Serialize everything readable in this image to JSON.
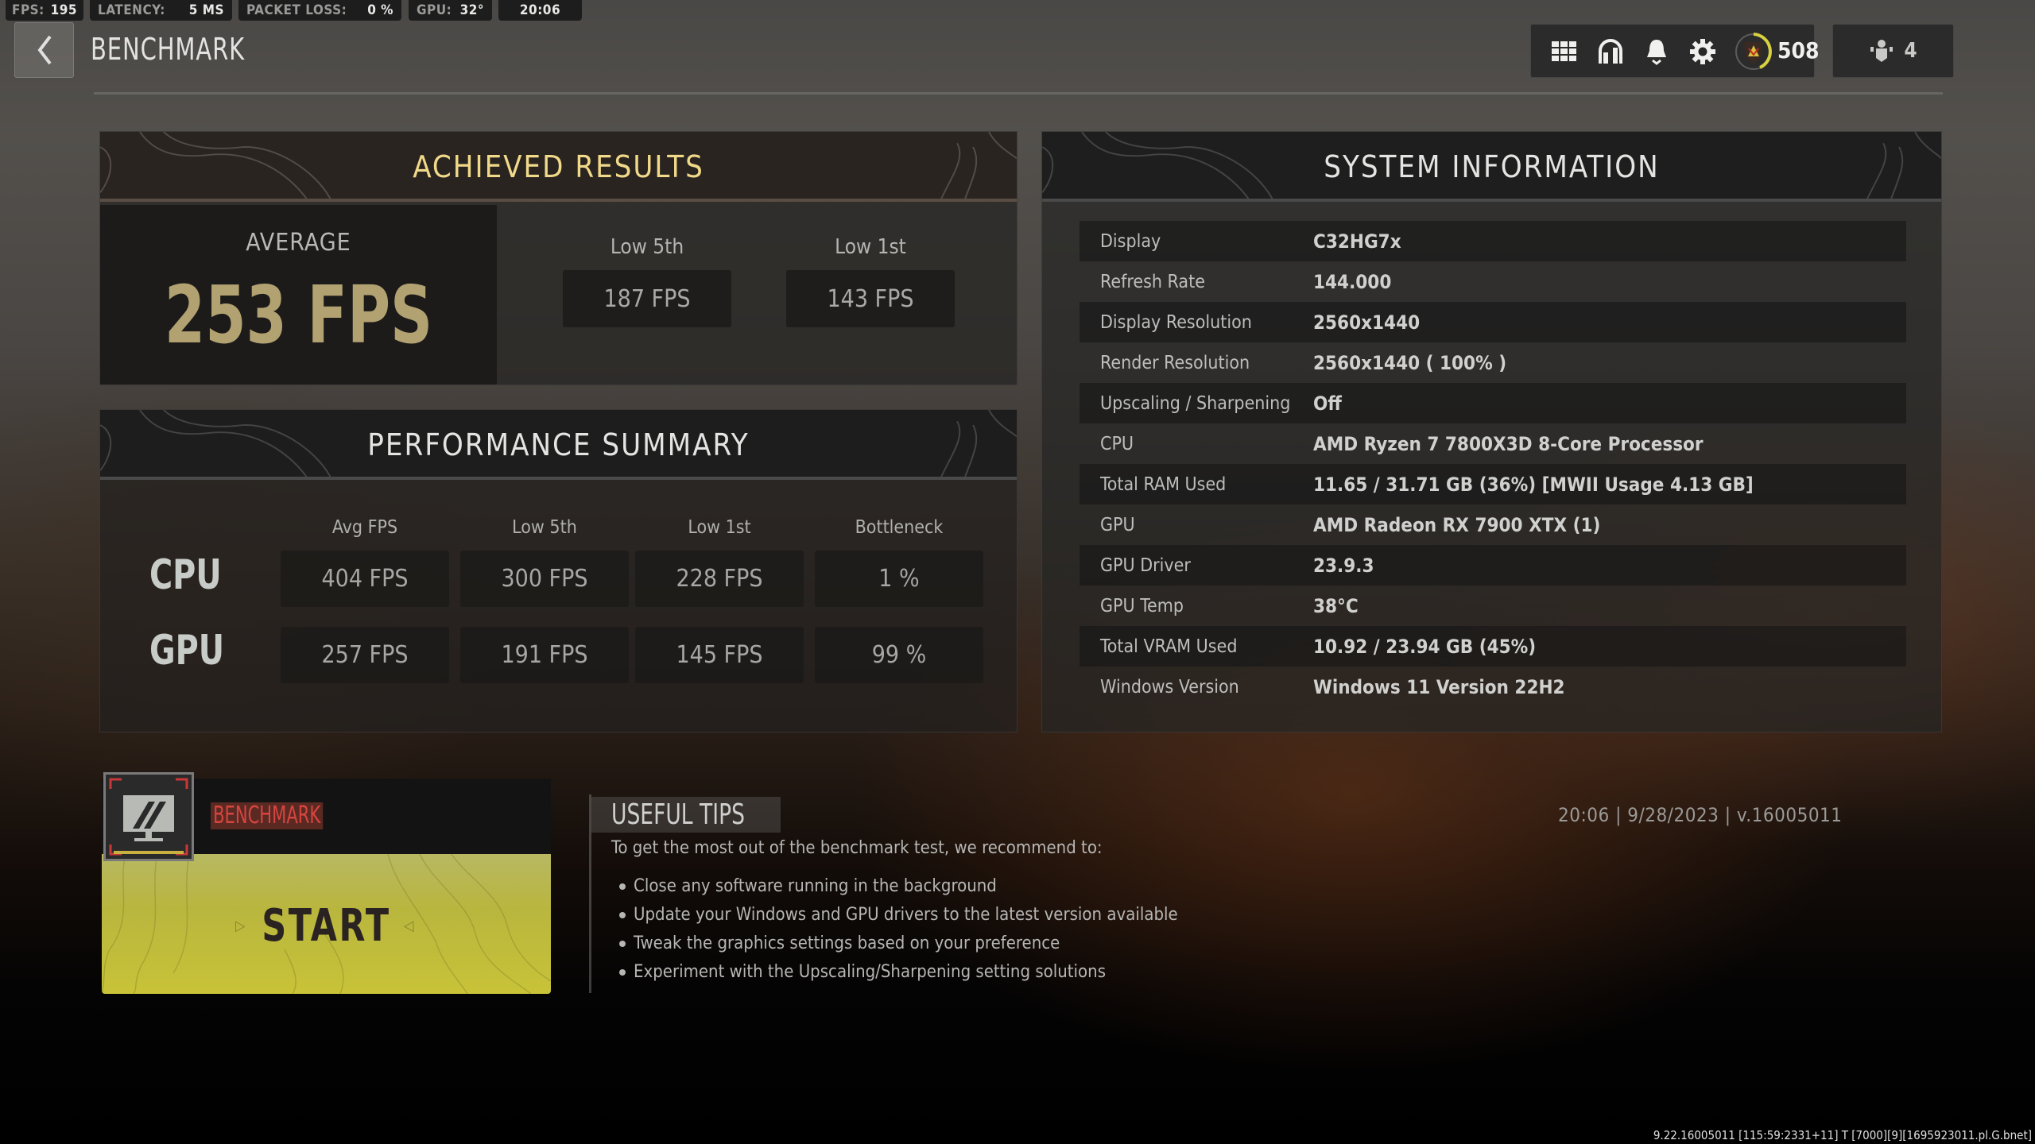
{
  "status_bar": [
    {
      "key": "FPS:",
      "value": "195"
    },
    {
      "key": "LATENCY:",
      "value": "5 MS"
    },
    {
      "key": "PACKET LOSS:",
      "value": "0 %"
    },
    {
      "key": "GPU:",
      "value": "32°"
    },
    {
      "key": "",
      "value": "20:06"
    }
  ],
  "header": {
    "title": "BENCHMARK",
    "icons": [
      "grid-menu-icon",
      "headset-icon",
      "bell-icon",
      "gear-icon",
      "rank-emblem-icon"
    ],
    "rank_value": "508",
    "party_count": "4"
  },
  "achieved": {
    "title": "ACHIEVED RESULTS",
    "average_label": "AVERAGE",
    "average_value": "253 FPS",
    "low5_label": "Low 5th",
    "low5_value": "187 FPS",
    "low1_label": "Low 1st",
    "low1_value": "143 FPS"
  },
  "performance": {
    "title": "PERFORMANCE SUMMARY",
    "columns": [
      "Avg FPS",
      "Low 5th",
      "Low 1st",
      "Bottleneck"
    ],
    "rows": [
      {
        "label": "CPU",
        "values": [
          "404 FPS",
          "300 FPS",
          "228 FPS",
          "1 %"
        ]
      },
      {
        "label": "GPU",
        "values": [
          "257 FPS",
          "191 FPS",
          "145 FPS",
          "99 %"
        ]
      }
    ]
  },
  "system": {
    "title": "SYSTEM INFORMATION",
    "rows": [
      {
        "key": "Display",
        "value": "C32HG7x"
      },
      {
        "key": "Refresh Rate",
        "value": "144.000"
      },
      {
        "key": "Display Resolution",
        "value": "2560x1440"
      },
      {
        "key": "Render Resolution",
        "value": "2560x1440 ( 100% )"
      },
      {
        "key": "Upscaling / Sharpening",
        "value": "Off"
      },
      {
        "key": "CPU",
        "value": "AMD Ryzen 7 7800X3D 8-Core Processor"
      },
      {
        "key": "Total RAM Used",
        "value": "11.65 / 31.71 GB (36%) [MWII Usage 4.13 GB]"
      },
      {
        "key": "GPU",
        "value": "AMD Radeon RX 7900 XTX (1)"
      },
      {
        "key": "GPU Driver",
        "value": "23.9.3"
      },
      {
        "key": "GPU Temp",
        "value": "38°C"
      },
      {
        "key": "Total VRAM Used",
        "value": "10.92 / 23.94 GB (45%)"
      },
      {
        "key": "Windows Version",
        "value": "Windows 11 Version 22H2"
      }
    ]
  },
  "start_card": {
    "mode_tag": "BENCHMARK",
    "start_label": "START",
    "colors": {
      "start": "#c8c338",
      "tag": "#d84440"
    }
  },
  "tips": {
    "title": "USEFUL TIPS",
    "intro": "To get the most out of the benchmark test, we recommend to:",
    "items": [
      "Close any software running in the background",
      "Update your Windows and GPU drivers to the latest version available",
      "Tweak the graphics settings based on your preference",
      "Experiment with the Upscaling/Sharpening setting solutions"
    ]
  },
  "datestamp": "20:06 | 9/28/2023 | v.16005011",
  "build_info": "9.22.16005011 [115:59:2331+11] T [7000][9][1695923011.pl.G.bnet]"
}
